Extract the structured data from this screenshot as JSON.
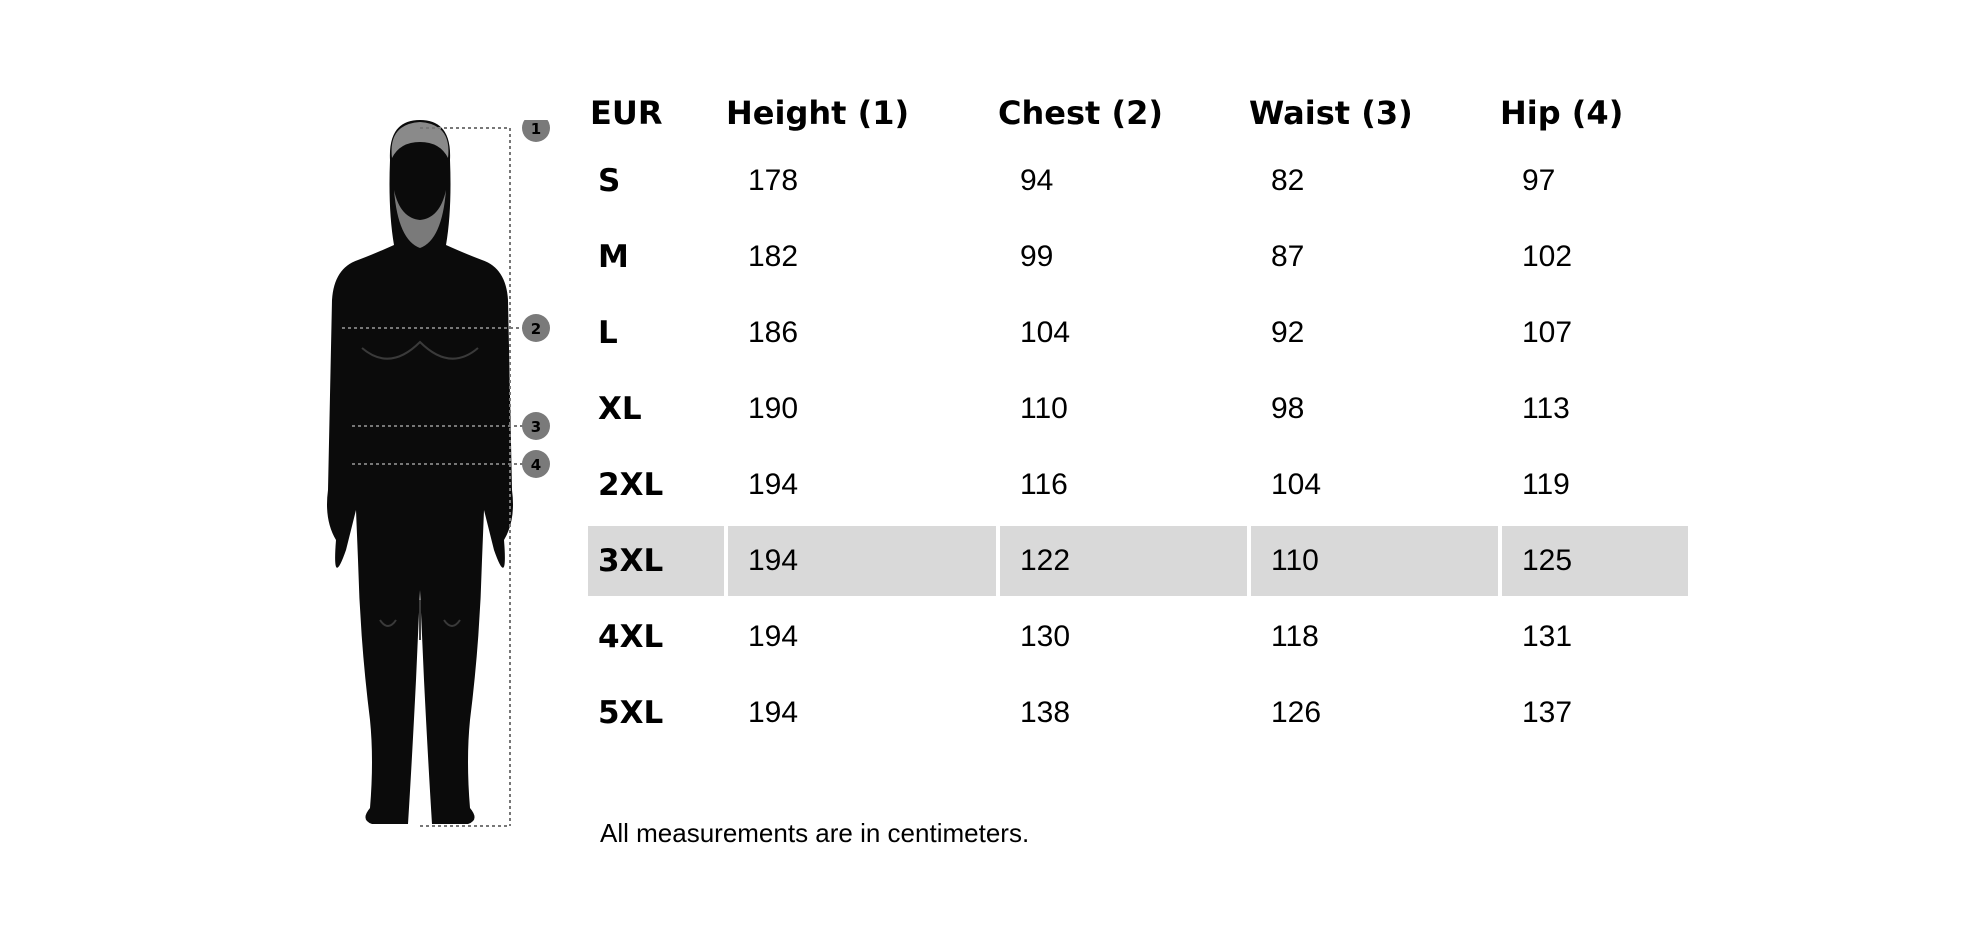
{
  "headers": [
    "EUR",
    "Height (1)",
    "Chest (2)",
    "Waist (3)",
    "Hip (4)"
  ],
  "rows": [
    {
      "size": "S",
      "height": "178",
      "chest": "94",
      "waist": "82",
      "hip": "97"
    },
    {
      "size": "M",
      "height": "182",
      "chest": "99",
      "waist": "87",
      "hip": "102"
    },
    {
      "size": "L",
      "height": "186",
      "chest": "104",
      "waist": "92",
      "hip": "107"
    },
    {
      "size": "XL",
      "height": "190",
      "chest": "110",
      "waist": "98",
      "hip": "113"
    },
    {
      "size": "2XL",
      "height": "194",
      "chest": "116",
      "waist": "104",
      "hip": "119"
    },
    {
      "size": "3XL",
      "height": "194",
      "chest": "122",
      "waist": "110",
      "hip": "125"
    },
    {
      "size": "4XL",
      "height": "194",
      "chest": "130",
      "waist": "118",
      "hip": "131"
    },
    {
      "size": "5XL",
      "height": "194",
      "chest": "138",
      "waist": "126",
      "hip": "137"
    }
  ],
  "highlighted_row": "3XL",
  "highlight_color": "#d9d9d9",
  "figure": {
    "icon": "male-body-silhouette-icon",
    "markers": [
      "1",
      "2",
      "3",
      "4"
    ]
  },
  "footnote": "All measurements are in centimeters."
}
